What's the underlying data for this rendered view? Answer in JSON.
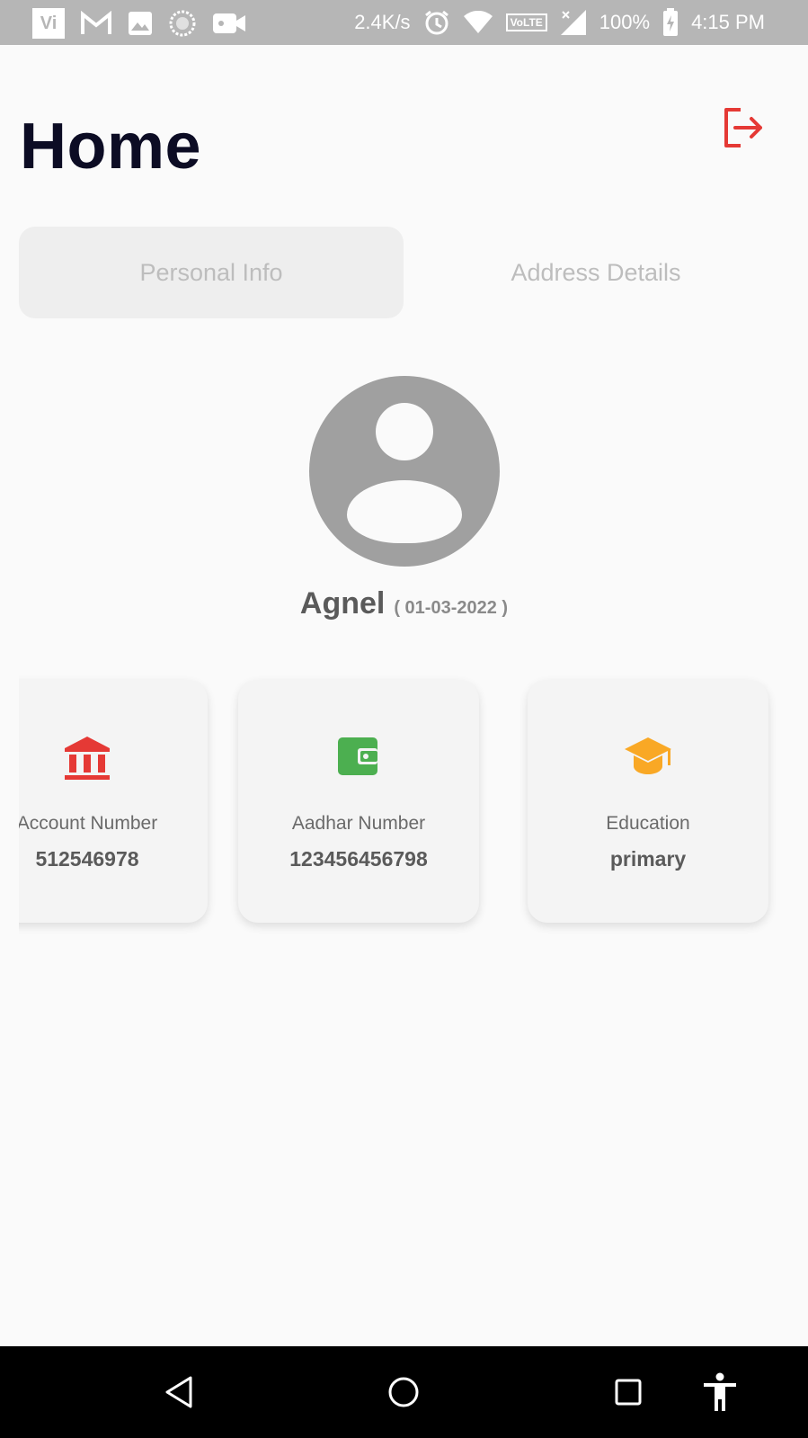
{
  "status_bar": {
    "carrier_logo": "Vi",
    "net_speed": "2.4K/s",
    "volte": "VoLTE",
    "battery": "100%",
    "time": "4:15 PM",
    "icons": [
      "gmail-icon",
      "image-icon",
      "sync-icon",
      "video-icon",
      "alarm-icon",
      "wifi-icon",
      "signal-icon",
      "battery-charging-icon"
    ]
  },
  "header": {
    "title": "Home"
  },
  "tabs": [
    {
      "label": "Personal Info",
      "selected": true
    },
    {
      "label": "Address Details",
      "selected": false
    }
  ],
  "profile": {
    "name": "Agnel",
    "dob": "( 01-03-2022 )"
  },
  "cards": [
    {
      "icon": "bank-icon",
      "label": "Account Number",
      "value": "512546978",
      "color": "#e53935"
    },
    {
      "icon": "wallet-icon",
      "label": "Aadhar Number",
      "value": "123456456798",
      "color": "#4caf50"
    },
    {
      "icon": "graduation-cap-icon",
      "label": "Education",
      "value": "primary",
      "color": "#f9a825"
    }
  ],
  "colors": {
    "logout": "#e53935",
    "title": "#0c0c24",
    "background": "#fafafa"
  }
}
